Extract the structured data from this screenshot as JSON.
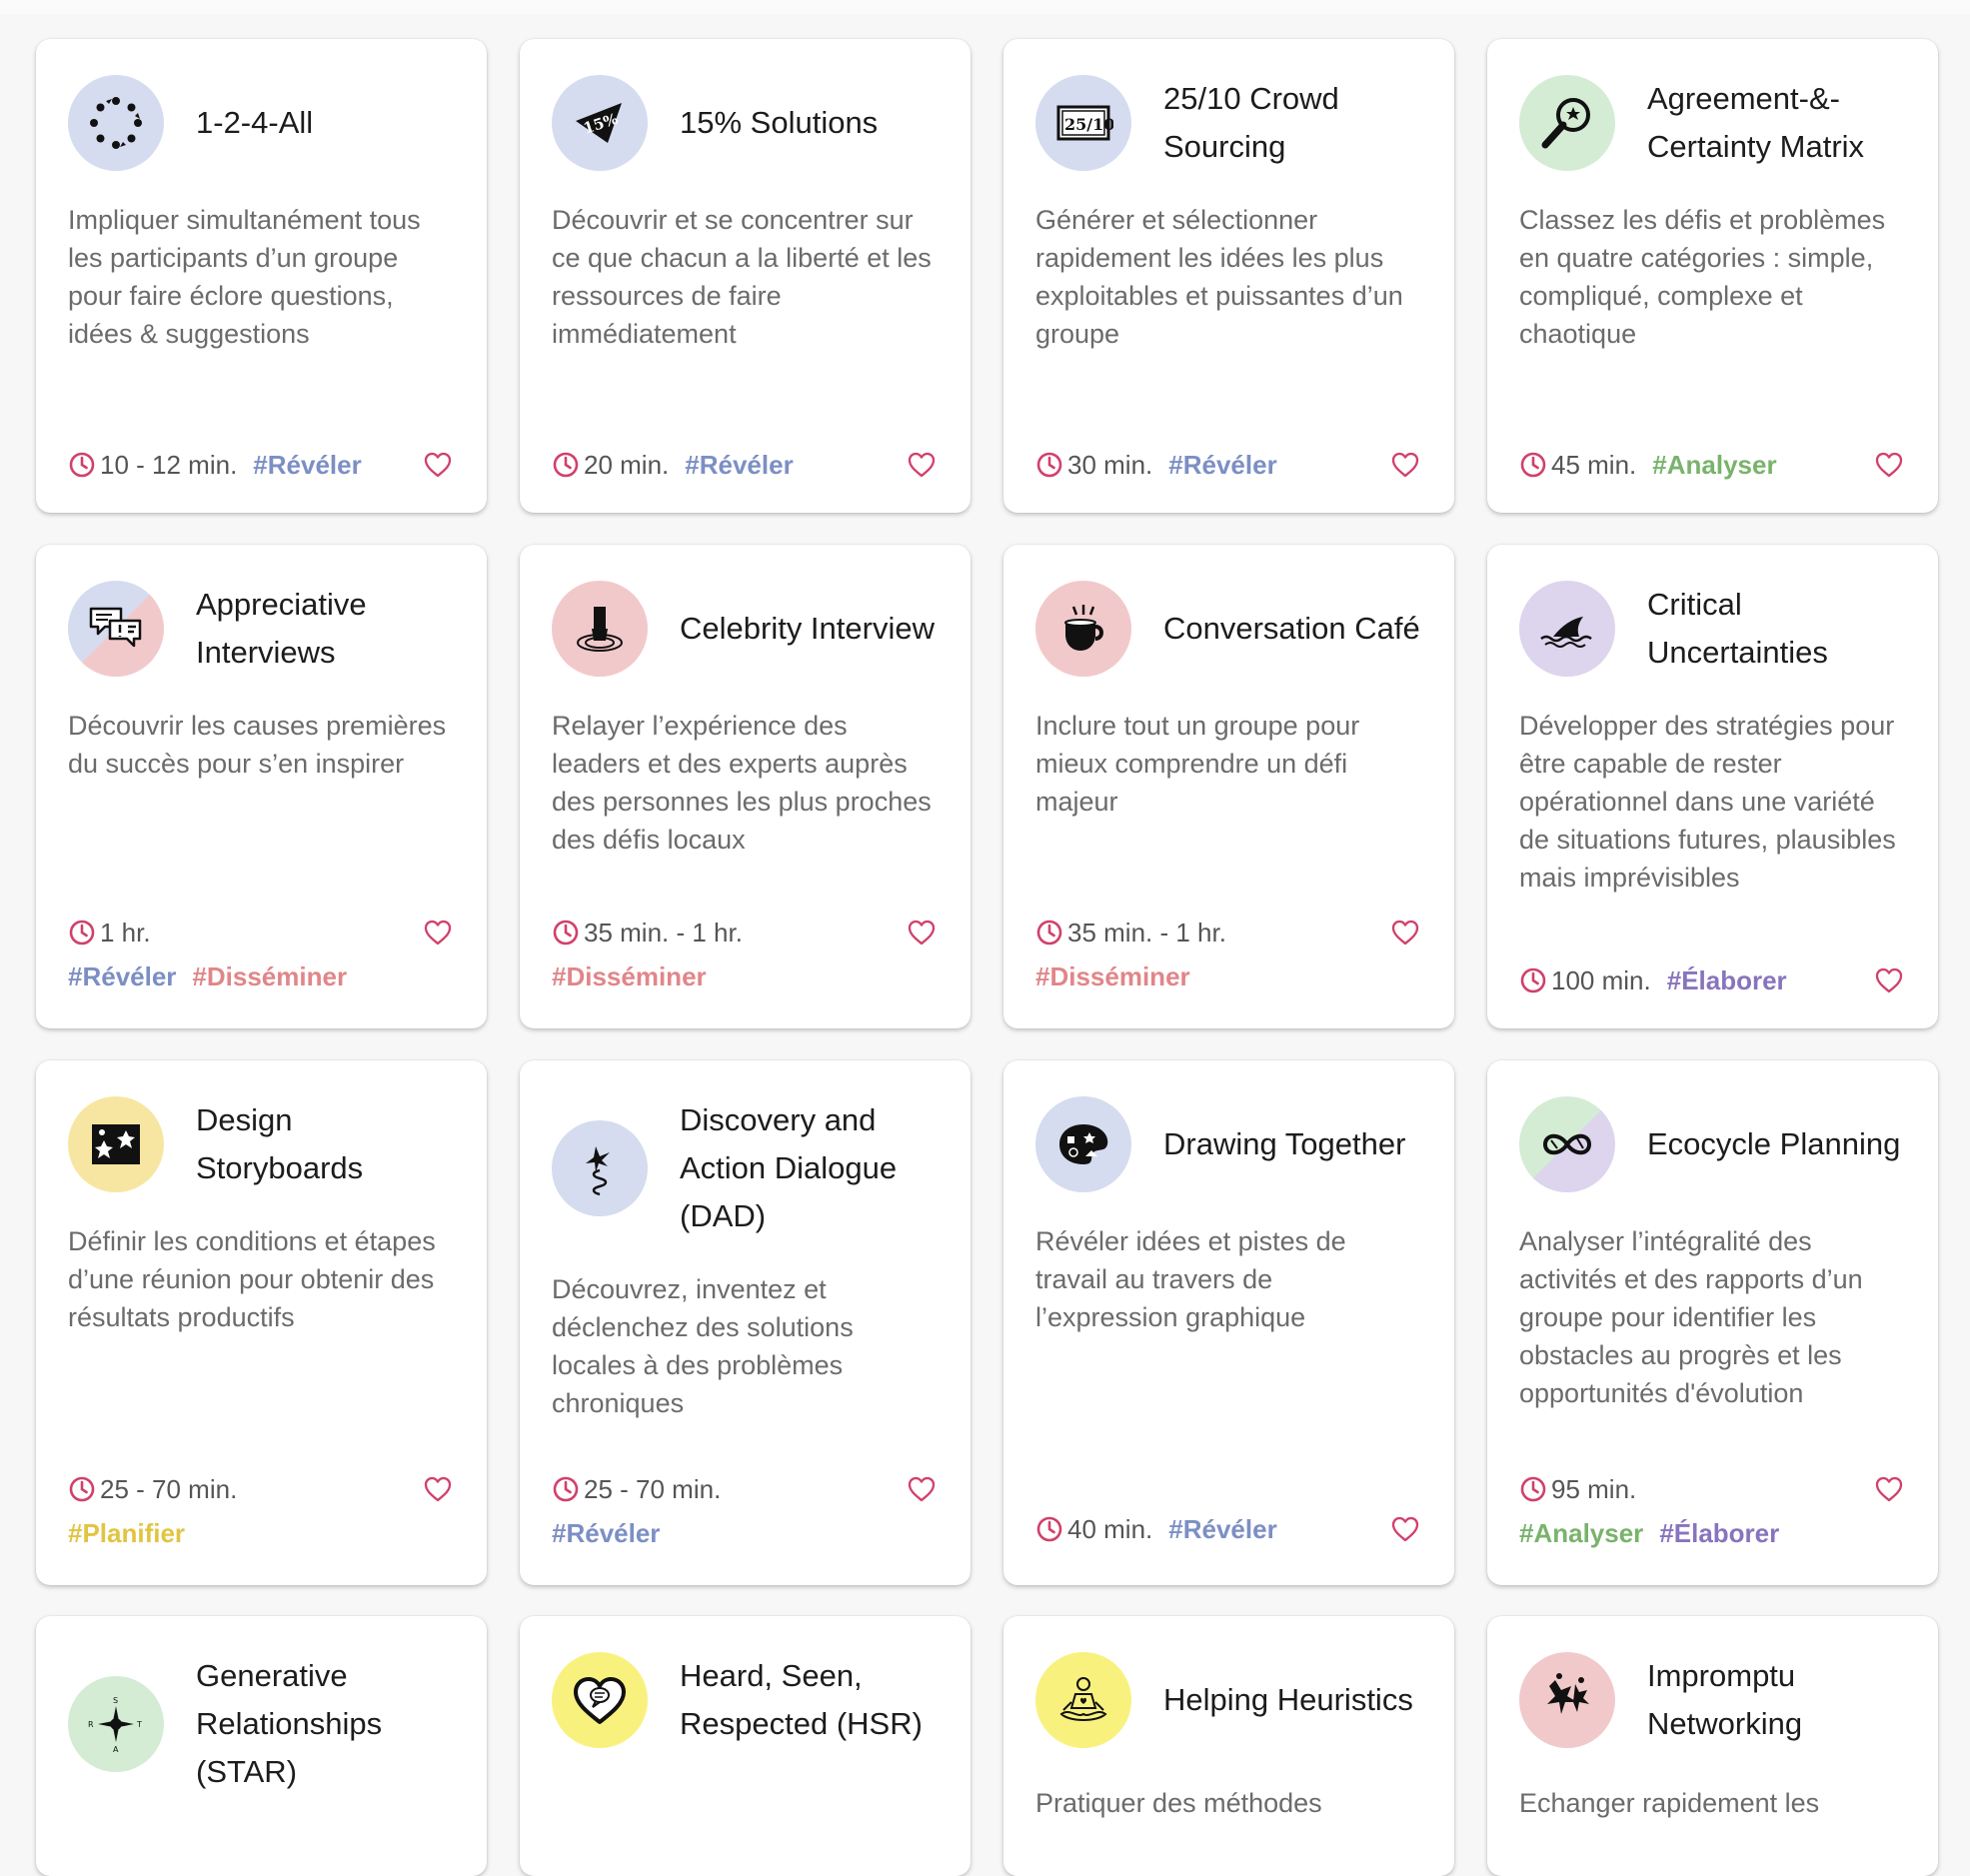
{
  "colors": {
    "reveler": "#7c8fc4",
    "disseminer": "#e08689",
    "analyser": "#79b36b",
    "elaborer": "#8874bd",
    "planifier": "#e1c441",
    "accent_pink": "#d1406a"
  },
  "cards": [
    {
      "title": "1-2-4-All",
      "desc": "Impliquer simultanément tous les participants d’un groupe pour faire éclore questions, idées & suggestions",
      "duration": "10 - 12 min.",
      "tags": [
        "#Révéler"
      ],
      "icon": "circle-of-dots-icon"
    },
    {
      "title": "15% Solutions",
      "desc": "Découvrir et se concentrer sur ce que chacun a la liberté et les ressources de faire immédiatement",
      "duration": "20 min.",
      "tags": [
        "#Révéler"
      ],
      "icon": "fifteen-percent-icon"
    },
    {
      "title": "25/10 Crowd Sourcing",
      "desc": "Générer et sélectionner rapidement les idées les plus exploitables et puissantes d’un groupe",
      "duration": "30 min.",
      "tags": [
        "#Révéler"
      ],
      "icon": "score-card-icon"
    },
    {
      "title": "Agreement-&-Certainty Matrix",
      "desc": "Classez les défis et problèmes en quatre catégories : simple, compliqué, complexe et chaotique",
      "duration": "45 min.",
      "tags": [
        "#Analyser"
      ],
      "icon": "magnifier-icon"
    },
    {
      "title": "Appreciative Interviews",
      "desc": "Découvrir les causes premières du succès pour s’en inspirer",
      "duration": "1 hr.",
      "tags": [
        "#Révéler",
        "#Disséminer"
      ],
      "icon": "speech-bubbles-icon"
    },
    {
      "title": "Celebrity Interview",
      "desc": "Relayer l’expérience des leaders et des experts auprès des personnes les plus proches des défis locaux",
      "duration": "35 min. - 1 hr.",
      "tags": [
        "#Disséminer"
      ],
      "icon": "chair-icon"
    },
    {
      "title": "Conversation Café",
      "desc": "Inclure tout un groupe pour mieux comprendre un défi majeur",
      "duration": "35 min. - 1 hr.",
      "tags": [
        "#Disséminer"
      ],
      "icon": "coffee-cup-icon"
    },
    {
      "title": "Critical Uncertainties",
      "desc": "Développer des stratégies pour être capable de rester opérationnel dans une variété de situations futures, plausibles mais imprévisibles",
      "duration": "100 min.",
      "tags": [
        "#Élaborer"
      ],
      "icon": "shark-fin-icon"
    },
    {
      "title": "Design Storyboards",
      "desc": "Définir les conditions et étapes d’une réunion pour obtenir des résultats productifs",
      "duration": "25 - 70 min.",
      "tags": [
        "#Planifier"
      ],
      "icon": "storyboard-icon"
    },
    {
      "title": "Discovery and Action Dialogue (DAD)",
      "desc": "Découvrez, inventez et déclenchez des solutions locales à des problèmes chroniques",
      "duration": "25 - 70 min.",
      "tags": [
        "#Révéler"
      ],
      "icon": "jack-in-box-icon"
    },
    {
      "title": "Drawing Together",
      "desc": "Révéler idées et pistes de travail au travers de l’expression graphique",
      "duration": "40 min.",
      "tags": [
        "#Révéler"
      ],
      "icon": "palette-icon"
    },
    {
      "title": "Ecocycle Planning",
      "desc": "Analyser l’intégralité des activités et des rapports d’un groupe pour identifier les obstacles au progrès et les opportunités d'évolution",
      "duration": "95 min.",
      "tags": [
        "#Analyser",
        "#Élaborer"
      ],
      "icon": "infinity-icon"
    },
    {
      "title": "Generative Relationships (STAR)",
      "icon": "compass-star-icon"
    },
    {
      "title": "Heard, Seen, Respected (HSR)",
      "icon": "heart-speech-icon"
    },
    {
      "title": "Helping Heuristics",
      "desc": "Pratiquer des méthodes",
      "icon": "meditating-person-icon"
    },
    {
      "title": "Impromptu Networking",
      "desc": "Echanger rapidement les",
      "icon": "running-figures-icon"
    }
  ]
}
